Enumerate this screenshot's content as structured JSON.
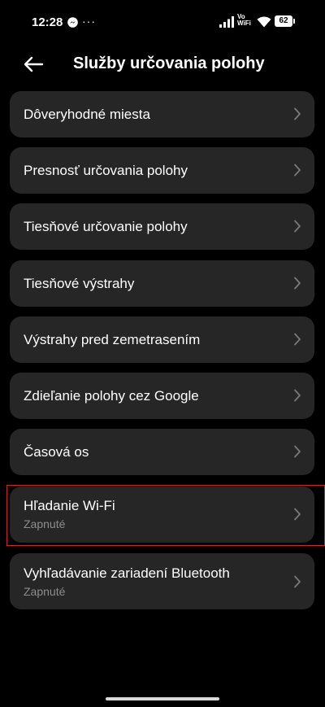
{
  "status_bar": {
    "time": "12:28",
    "notification_dots": "···",
    "vowifi_top": "Vo",
    "vowifi_bottom": "WiFi",
    "battery_level": "62",
    "icons": [
      "messenger-icon",
      "more-dots-icon",
      "signal-icon",
      "vowifi-icon",
      "wifi-icon",
      "battery-icon"
    ]
  },
  "header": {
    "title": "Služby určovania polohy",
    "back_icon": "arrow-left-icon"
  },
  "items": [
    {
      "label": "Dôveryhodné miesta"
    },
    {
      "label": "Presnosť určovania polohy"
    },
    {
      "label": "Tiesňové určovanie polohy"
    },
    {
      "label": "Tiesňové výstrahy"
    },
    {
      "label": "Výstrahy pred zemetrasením"
    },
    {
      "label": "Zdieľanie polohy cez Google"
    },
    {
      "label": "Časová os"
    },
    {
      "label": "Hľadanie Wi-Fi",
      "sublabel": "Zapnuté"
    },
    {
      "label": "Vyhľadávanie zariadení Bluetooth",
      "sublabel": "Zapnuté"
    }
  ],
  "colors": {
    "background": "#000000",
    "card": "#262626",
    "text": "#ffffff",
    "subtext": "#8c8c8c",
    "chevron": "#7a7a7a",
    "highlight": "#c62828"
  }
}
